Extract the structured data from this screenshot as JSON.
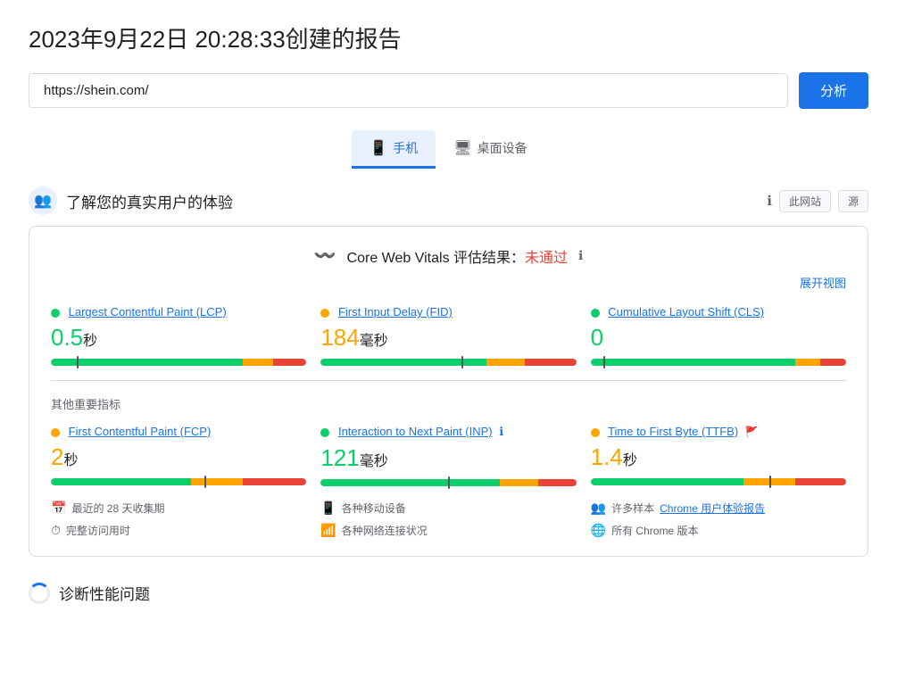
{
  "page": {
    "title": "2023年9月22日 20:28:33创建的报告",
    "url": "https://shein.com/",
    "analyze_btn": "分析"
  },
  "tabs": [
    {
      "id": "mobile",
      "label": "手机",
      "icon": "📱",
      "active": true
    },
    {
      "id": "desktop",
      "label": "桌面设备",
      "icon": "🖥",
      "active": false
    }
  ],
  "real_users_section": {
    "title": "了解您的真实用户的体验",
    "icon": "👥",
    "btn_this_site": "此网站",
    "btn_source": "源",
    "expand_text": "展开视图",
    "core_vitals": {
      "label": "Core Web Vitals 评估结果：",
      "status": "未通过"
    },
    "metrics": [
      {
        "id": "lcp",
        "label": "Largest Contentful Paint (LCP)",
        "dot_color": "green",
        "value": "0.5",
        "unit": "秒",
        "value_color": "green",
        "bar": {
          "green": 75,
          "orange": 12,
          "red": 13,
          "marker": 10
        }
      },
      {
        "id": "fid",
        "label": "First Input Delay (FID)",
        "dot_color": "orange",
        "value": "184",
        "unit": "毫秒",
        "value_color": "orange",
        "bar": {
          "green": 65,
          "orange": 15,
          "red": 20,
          "marker": 55
        }
      },
      {
        "id": "cls",
        "label": "Cumulative Layout Shift (CLS)",
        "dot_color": "green",
        "value": "0",
        "unit": "",
        "value_color": "green",
        "bar": {
          "green": 80,
          "orange": 10,
          "red": 10,
          "marker": 5
        }
      }
    ],
    "other_metrics_label": "其他重要指标",
    "other_metrics": [
      {
        "id": "fcp",
        "label": "First Contentful Paint (FCP)",
        "dot_color": "orange",
        "value": "2",
        "unit": "秒",
        "value_color": "orange",
        "bar": {
          "green": 55,
          "orange": 20,
          "red": 25,
          "marker": 60
        }
      },
      {
        "id": "inp",
        "label": "Interaction to Next Paint (INP)",
        "dot_color": "green",
        "value": "121",
        "unit": "毫秒",
        "value_color": "green",
        "bar": {
          "green": 70,
          "orange": 15,
          "red": 15,
          "marker": 50
        }
      },
      {
        "id": "ttfb",
        "label": "Time to First Byte (TTFB)",
        "dot_color": "orange",
        "value": "1.4",
        "unit": "秒",
        "value_color": "orange",
        "bar": {
          "green": 60,
          "orange": 20,
          "red": 20,
          "marker": 70
        }
      }
    ],
    "footer_info": [
      {
        "icon": "📅",
        "text": "最近的 28 天收集期"
      },
      {
        "icon": "📱",
        "text": "各种移动设备"
      },
      {
        "icon": "👥",
        "text_prefix": "许多样本 ",
        "link": "Chrome 用户体验报告",
        "text_suffix": ""
      },
      {
        "icon": "⏱",
        "text": "完整访问用时"
      },
      {
        "icon": "📶",
        "text": "各种网络连接状况"
      },
      {
        "icon": "🌐",
        "text": "所有 Chrome 版本"
      }
    ]
  },
  "diagnostic": {
    "title": "诊断性能问题"
  }
}
